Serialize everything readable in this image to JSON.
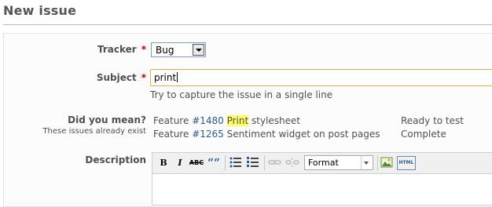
{
  "page": {
    "title": "New issue"
  },
  "form": {
    "tracker": {
      "label": "Tracker",
      "required": "*",
      "value": "Bug"
    },
    "subject": {
      "label": "Subject",
      "required": "*",
      "value": "print",
      "hint": "Try to capture the issue in a single line"
    },
    "did_you_mean": {
      "label": "Did you mean?",
      "sublabel": "These issues already exist",
      "suggestions": [
        {
          "tracker": "Feature",
          "id": "#1480",
          "match": "Print",
          "rest": " stylesheet",
          "status": "Ready to test"
        },
        {
          "tracker": "Feature",
          "id": "#1265",
          "match": "",
          "rest": "Sentiment widget on post pages",
          "status": "Complete"
        }
      ]
    },
    "description": {
      "label": "Description",
      "toolbar": {
        "bold": "B",
        "italic": "I",
        "strike": "ABC",
        "quote": "““",
        "format": "Format",
        "html": "HTML"
      }
    }
  }
}
